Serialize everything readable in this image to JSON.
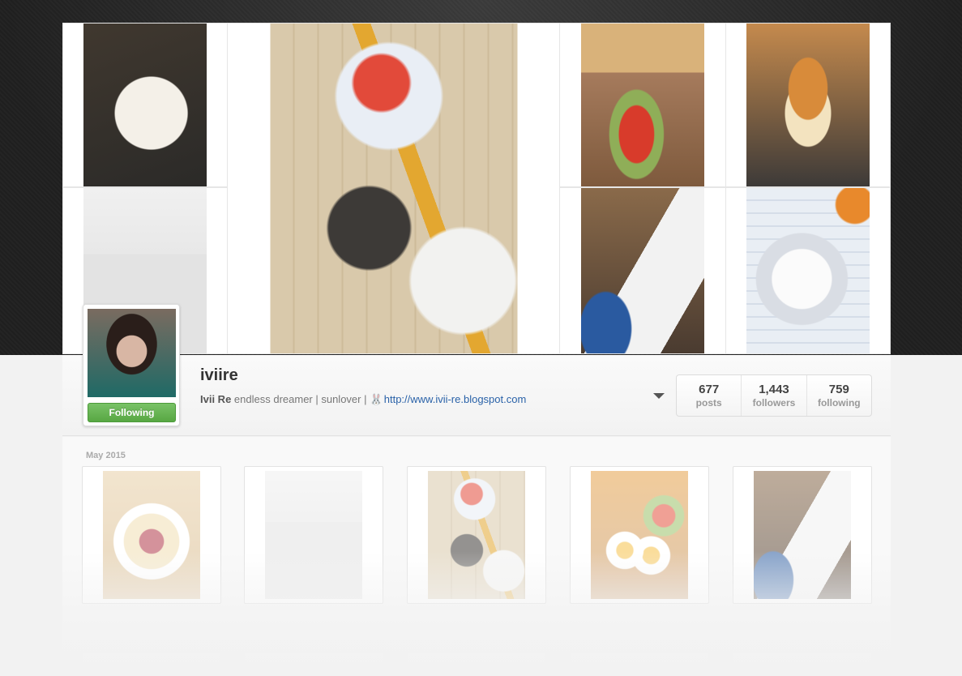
{
  "profile": {
    "username": "iviire",
    "full_name": "Ivii Re",
    "bio": "endless dreamer | sunlover |",
    "bio_icon": "bunny-emoji",
    "link": "http://www.ivii-re.blogspot.com",
    "follow_button_label": "Following",
    "follow_button_color": "#66b453"
  },
  "stats": [
    {
      "value": "677",
      "label": "posts"
    },
    {
      "value": "1,443",
      "label": "followers"
    },
    {
      "value": "759",
      "label": "following"
    }
  ],
  "feed": {
    "month_label": "May 2015"
  },
  "colors": {
    "background_dark": "#1f1f1f",
    "link": "#2a62a8",
    "panel": "#f2f2f2"
  }
}
